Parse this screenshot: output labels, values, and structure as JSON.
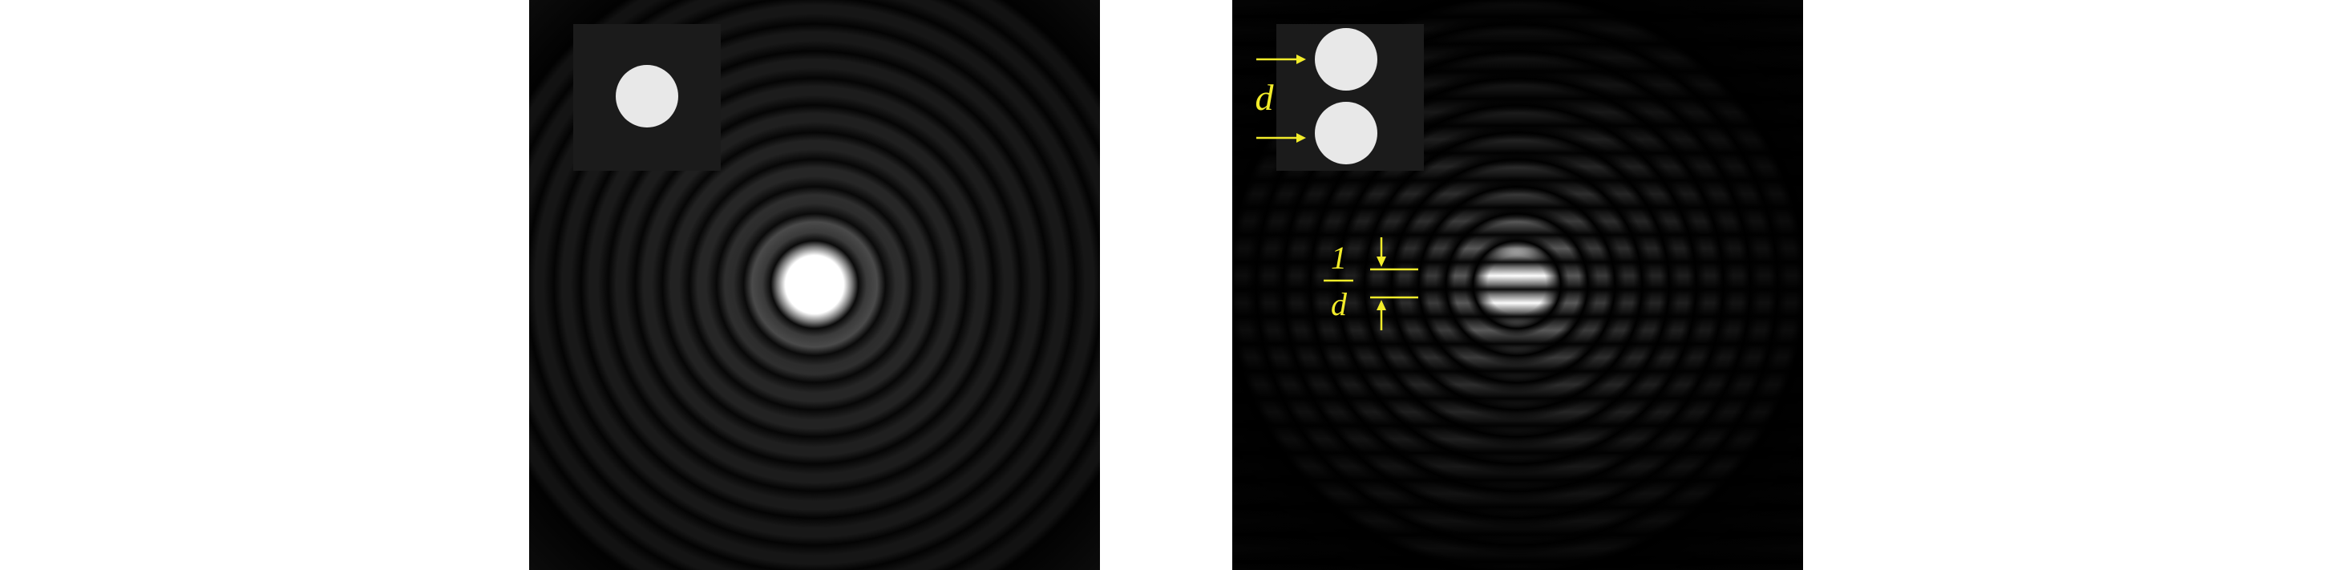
{
  "left_panel": {
    "inset": "single-circular-aperture",
    "pattern": "airy-rings"
  },
  "right_panel": {
    "inset": "double-circular-aperture",
    "pattern": "airy-rings-with-fringes",
    "labels": {
      "aperture_separation": "d",
      "fringe_numerator": "1",
      "fringe_denominator": "d"
    }
  },
  "colors": {
    "background": "#000000",
    "inset_background": "#1b1b1b",
    "aperture": "#e8e8e8",
    "annotation": "#f2ec2a"
  }
}
